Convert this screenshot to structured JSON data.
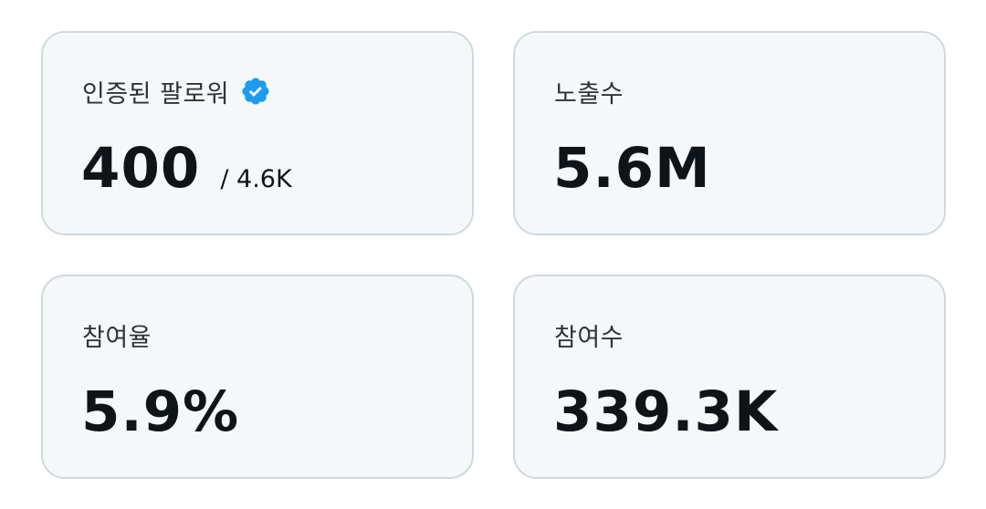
{
  "cards": [
    {
      "label": "인증된 팔로워",
      "value": "400",
      "sub": "/ 4.6K",
      "icon": "verified-badge-icon",
      "icon_color": "#1d9bf0"
    },
    {
      "label": "노출수",
      "value": "5.6M"
    },
    {
      "label": "참여율",
      "value": "5.9%"
    },
    {
      "label": "참여수",
      "value": "339.3K"
    }
  ],
  "colors": {
    "card_bg": "#f5f8f8",
    "card_border": "#cfd9de",
    "value_text": "#0f1419",
    "label_text": "#2f3336"
  }
}
